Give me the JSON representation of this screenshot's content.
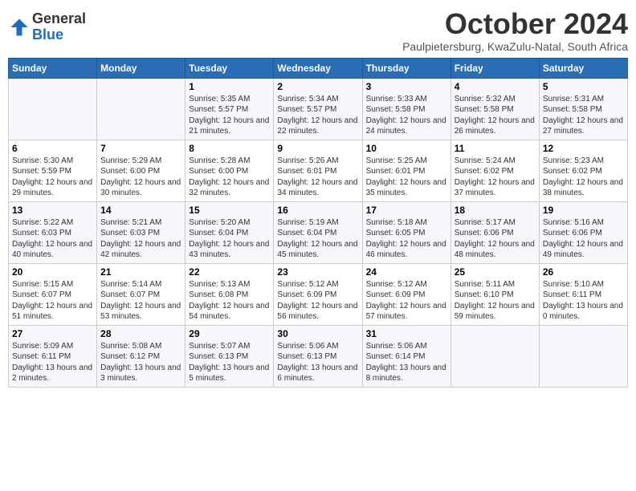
{
  "logo": {
    "general": "General",
    "blue": "Blue"
  },
  "title": "October 2024",
  "subtitle": "Paulpietersburg, KwaZulu-Natal, South Africa",
  "days_of_week": [
    "Sunday",
    "Monday",
    "Tuesday",
    "Wednesday",
    "Thursday",
    "Friday",
    "Saturday"
  ],
  "weeks": [
    [
      {
        "day": "",
        "sunrise": "",
        "sunset": "",
        "daylight": ""
      },
      {
        "day": "",
        "sunrise": "",
        "sunset": "",
        "daylight": ""
      },
      {
        "day": "1",
        "sunrise": "Sunrise: 5:35 AM",
        "sunset": "Sunset: 5:57 PM",
        "daylight": "Daylight: 12 hours and 21 minutes."
      },
      {
        "day": "2",
        "sunrise": "Sunrise: 5:34 AM",
        "sunset": "Sunset: 5:57 PM",
        "daylight": "Daylight: 12 hours and 22 minutes."
      },
      {
        "day": "3",
        "sunrise": "Sunrise: 5:33 AM",
        "sunset": "Sunset: 5:58 PM",
        "daylight": "Daylight: 12 hours and 24 minutes."
      },
      {
        "day": "4",
        "sunrise": "Sunrise: 5:32 AM",
        "sunset": "Sunset: 5:58 PM",
        "daylight": "Daylight: 12 hours and 26 minutes."
      },
      {
        "day": "5",
        "sunrise": "Sunrise: 5:31 AM",
        "sunset": "Sunset: 5:58 PM",
        "daylight": "Daylight: 12 hours and 27 minutes."
      }
    ],
    [
      {
        "day": "6",
        "sunrise": "Sunrise: 5:30 AM",
        "sunset": "Sunset: 5:59 PM",
        "daylight": "Daylight: 12 hours and 29 minutes."
      },
      {
        "day": "7",
        "sunrise": "Sunrise: 5:29 AM",
        "sunset": "Sunset: 6:00 PM",
        "daylight": "Daylight: 12 hours and 30 minutes."
      },
      {
        "day": "8",
        "sunrise": "Sunrise: 5:28 AM",
        "sunset": "Sunset: 6:00 PM",
        "daylight": "Daylight: 12 hours and 32 minutes."
      },
      {
        "day": "9",
        "sunrise": "Sunrise: 5:26 AM",
        "sunset": "Sunset: 6:01 PM",
        "daylight": "Daylight: 12 hours and 34 minutes."
      },
      {
        "day": "10",
        "sunrise": "Sunrise: 5:25 AM",
        "sunset": "Sunset: 6:01 PM",
        "daylight": "Daylight: 12 hours and 35 minutes."
      },
      {
        "day": "11",
        "sunrise": "Sunrise: 5:24 AM",
        "sunset": "Sunset: 6:02 PM",
        "daylight": "Daylight: 12 hours and 37 minutes."
      },
      {
        "day": "12",
        "sunrise": "Sunrise: 5:23 AM",
        "sunset": "Sunset: 6:02 PM",
        "daylight": "Daylight: 12 hours and 38 minutes."
      }
    ],
    [
      {
        "day": "13",
        "sunrise": "Sunrise: 5:22 AM",
        "sunset": "Sunset: 6:03 PM",
        "daylight": "Daylight: 12 hours and 40 minutes."
      },
      {
        "day": "14",
        "sunrise": "Sunrise: 5:21 AM",
        "sunset": "Sunset: 6:03 PM",
        "daylight": "Daylight: 12 hours and 42 minutes."
      },
      {
        "day": "15",
        "sunrise": "Sunrise: 5:20 AM",
        "sunset": "Sunset: 6:04 PM",
        "daylight": "Daylight: 12 hours and 43 minutes."
      },
      {
        "day": "16",
        "sunrise": "Sunrise: 5:19 AM",
        "sunset": "Sunset: 6:04 PM",
        "daylight": "Daylight: 12 hours and 45 minutes."
      },
      {
        "day": "17",
        "sunrise": "Sunrise: 5:18 AM",
        "sunset": "Sunset: 6:05 PM",
        "daylight": "Daylight: 12 hours and 46 minutes."
      },
      {
        "day": "18",
        "sunrise": "Sunrise: 5:17 AM",
        "sunset": "Sunset: 6:06 PM",
        "daylight": "Daylight: 12 hours and 48 minutes."
      },
      {
        "day": "19",
        "sunrise": "Sunrise: 5:16 AM",
        "sunset": "Sunset: 6:06 PM",
        "daylight": "Daylight: 12 hours and 49 minutes."
      }
    ],
    [
      {
        "day": "20",
        "sunrise": "Sunrise: 5:15 AM",
        "sunset": "Sunset: 6:07 PM",
        "daylight": "Daylight: 12 hours and 51 minutes."
      },
      {
        "day": "21",
        "sunrise": "Sunrise: 5:14 AM",
        "sunset": "Sunset: 6:07 PM",
        "daylight": "Daylight: 12 hours and 53 minutes."
      },
      {
        "day": "22",
        "sunrise": "Sunrise: 5:13 AM",
        "sunset": "Sunset: 6:08 PM",
        "daylight": "Daylight: 12 hours and 54 minutes."
      },
      {
        "day": "23",
        "sunrise": "Sunrise: 5:12 AM",
        "sunset": "Sunset: 6:09 PM",
        "daylight": "Daylight: 12 hours and 56 minutes."
      },
      {
        "day": "24",
        "sunrise": "Sunrise: 5:12 AM",
        "sunset": "Sunset: 6:09 PM",
        "daylight": "Daylight: 12 hours and 57 minutes."
      },
      {
        "day": "25",
        "sunrise": "Sunrise: 5:11 AM",
        "sunset": "Sunset: 6:10 PM",
        "daylight": "Daylight: 12 hours and 59 minutes."
      },
      {
        "day": "26",
        "sunrise": "Sunrise: 5:10 AM",
        "sunset": "Sunset: 6:11 PM",
        "daylight": "Daylight: 13 hours and 0 minutes."
      }
    ],
    [
      {
        "day": "27",
        "sunrise": "Sunrise: 5:09 AM",
        "sunset": "Sunset: 6:11 PM",
        "daylight": "Daylight: 13 hours and 2 minutes."
      },
      {
        "day": "28",
        "sunrise": "Sunrise: 5:08 AM",
        "sunset": "Sunset: 6:12 PM",
        "daylight": "Daylight: 13 hours and 3 minutes."
      },
      {
        "day": "29",
        "sunrise": "Sunrise: 5:07 AM",
        "sunset": "Sunset: 6:13 PM",
        "daylight": "Daylight: 13 hours and 5 minutes."
      },
      {
        "day": "30",
        "sunrise": "Sunrise: 5:06 AM",
        "sunset": "Sunset: 6:13 PM",
        "daylight": "Daylight: 13 hours and 6 minutes."
      },
      {
        "day": "31",
        "sunrise": "Sunrise: 5:06 AM",
        "sunset": "Sunset: 6:14 PM",
        "daylight": "Daylight: 13 hours and 8 minutes."
      },
      {
        "day": "",
        "sunrise": "",
        "sunset": "",
        "daylight": ""
      },
      {
        "day": "",
        "sunrise": "",
        "sunset": "",
        "daylight": ""
      }
    ]
  ]
}
